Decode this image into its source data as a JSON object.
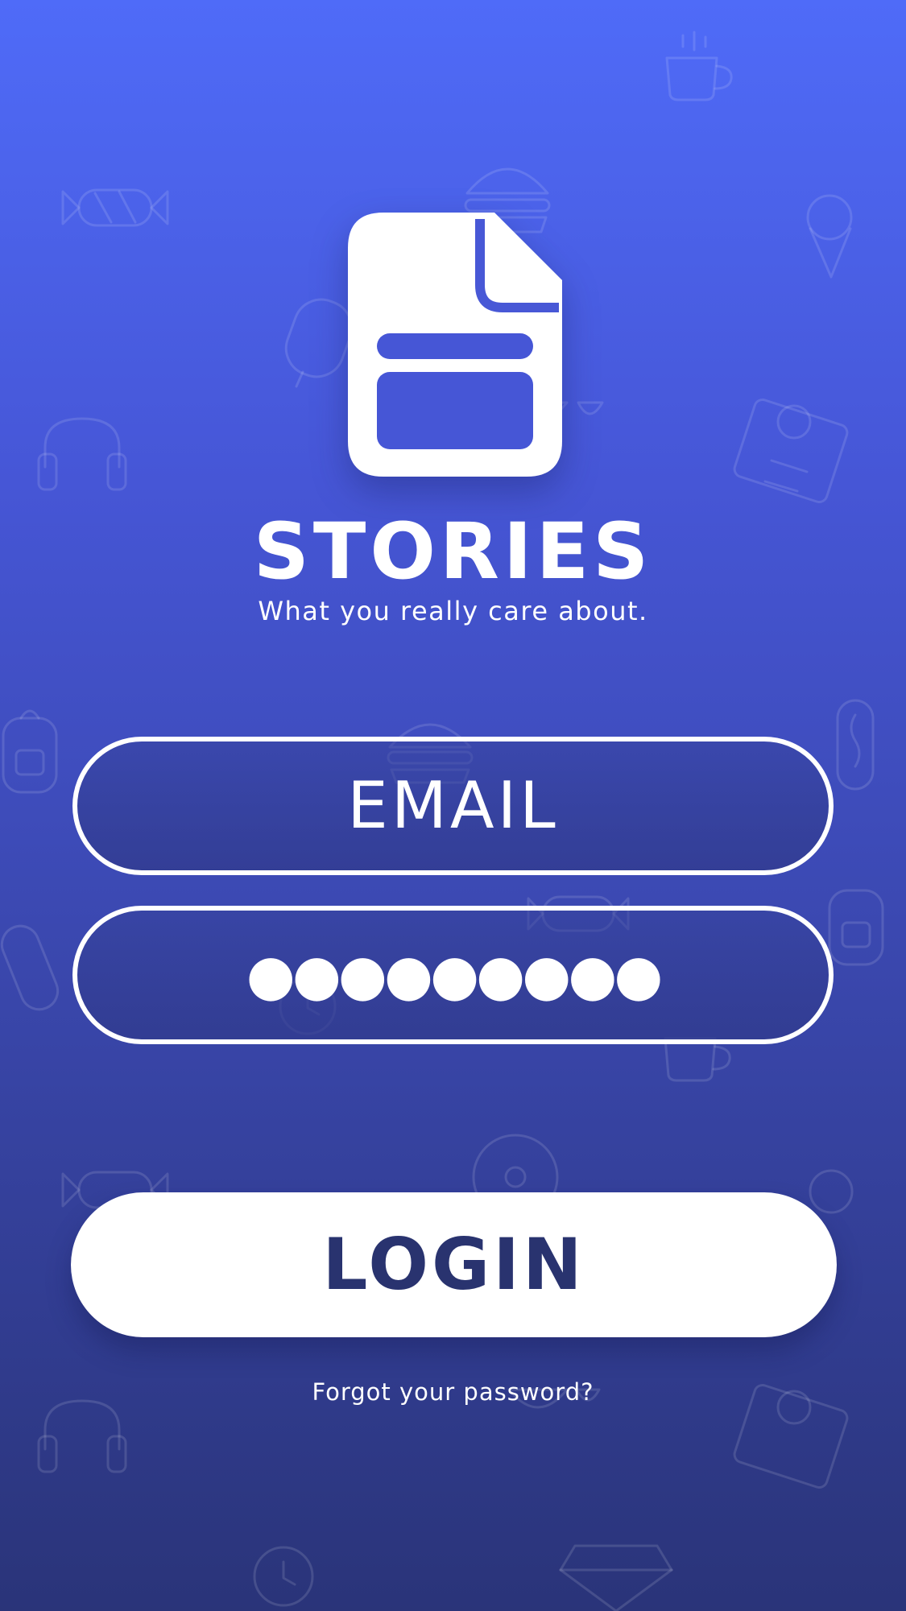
{
  "app": {
    "title": "STORIES",
    "tagline": "What you really care about."
  },
  "login_form": {
    "email_placeholder": "EMAIL",
    "password_value": "●●●●●●●●●",
    "login_button_label": "LOGIN",
    "forgot_password_label": "Forgot your password?"
  },
  "icons": {
    "logo": "document-icon",
    "background": [
      "candy-icon",
      "coffee-cup-icon",
      "burger-icon",
      "ice-cream-icon",
      "popsicle-icon",
      "headphones-icon",
      "shirt-icon",
      "watermelon-icon",
      "backpack-icon",
      "hot-dog-icon",
      "watch-icon",
      "vinyl-record-icon",
      "diamond-icon"
    ]
  },
  "colors": {
    "background_top": "#4f6bf8",
    "background_bottom": "#2a3479",
    "login_text": "#29336f",
    "foreground": "#ffffff"
  }
}
